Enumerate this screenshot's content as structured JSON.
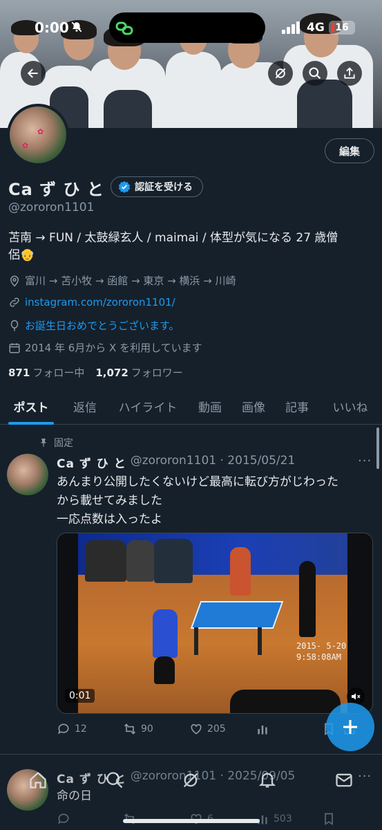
{
  "status_bar": {
    "time": "0:00",
    "network": "4G",
    "battery": "16"
  },
  "profile": {
    "display_name": "Ca ず ひ と",
    "verify_label": "認証を受ける",
    "edit_label": "編集",
    "handle": "@zororon1101",
    "bio_line1": "苫南 → FUN / 太鼓緑玄人 / maimai / 体型が気になる 27 歳僧",
    "bio_line2": "侶",
    "bio_emoji": "👴",
    "location": "富川 → 苫小牧 → 函館 → 東京 → 横浜 → 川崎",
    "website": "instagram.com/zororon1101/",
    "birthday": "お誕生日おめでとうございます。",
    "joined": "2014 年 6月から X を利用しています",
    "following_count": "871",
    "following_label": "フォロー中",
    "followers_count": "1,072",
    "followers_label": "フォロワー"
  },
  "tabs": [
    "ポスト",
    "返信",
    "ハイライト",
    "動画",
    "画像",
    "記事",
    "いいね"
  ],
  "posts": [
    {
      "pinned_label": "固定",
      "name": "Ca ず ひ と",
      "handle_date": "@zororon1101 · 2015/05/21",
      "line1": "あんまり公開したくないけど最高に転び方がじわった",
      "line2": "から載せてみました",
      "line3": "一応点数は入ったよ",
      "video_duration": "0:01",
      "video_stamp_line1": "2015- 5-20",
      "video_stamp_line2": "9:58:08AM",
      "replies": "12",
      "reposts": "90",
      "likes": "205",
      "views": ""
    },
    {
      "name": "Ca ず ひ と",
      "handle_date": "@zororon1101 · 2025/09/05",
      "line1": "命の日",
      "replies": "",
      "reposts": "",
      "likes": "6",
      "views": "503"
    }
  ],
  "colors": {
    "accent": "#1d9bf0",
    "background": "#15202b",
    "muted": "#8b98a5"
  }
}
